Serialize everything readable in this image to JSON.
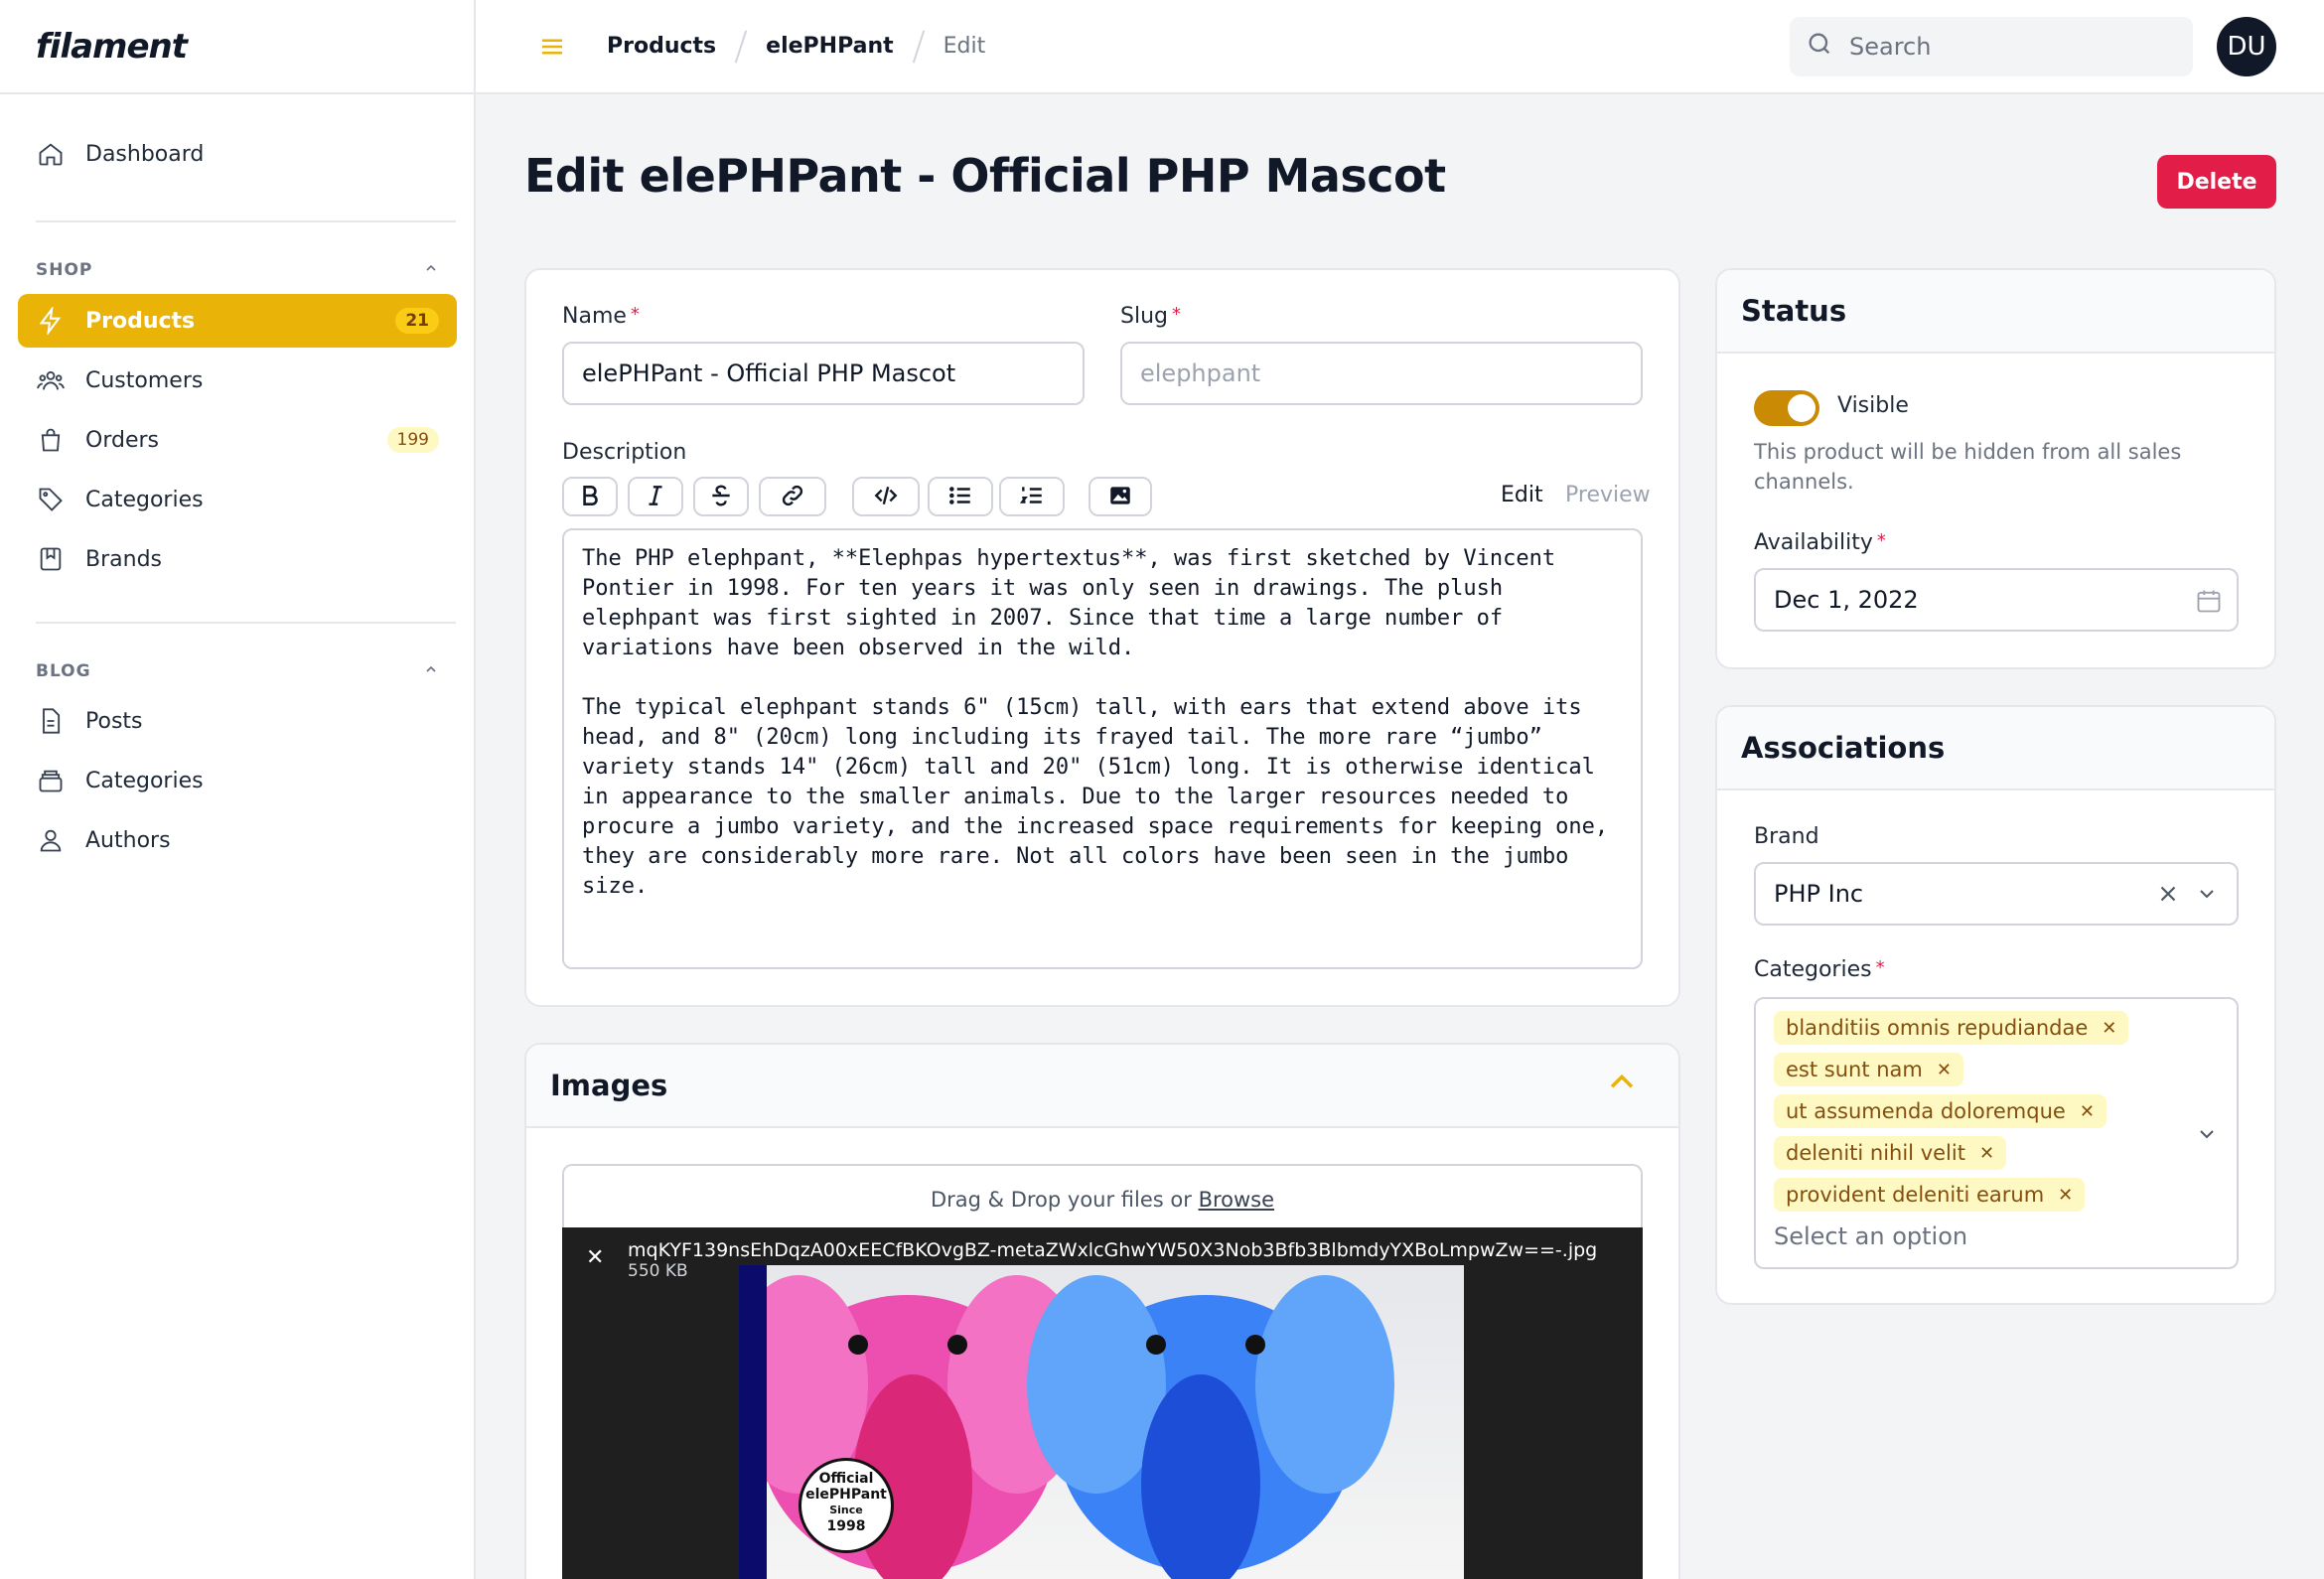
{
  "app": {
    "logo": "filament"
  },
  "sidebar": {
    "dashboard": "Dashboard",
    "shop": {
      "heading": "SHOP",
      "items": [
        {
          "label": "Products",
          "badge": "21",
          "active": true,
          "icon": "bolt-icon"
        },
        {
          "label": "Customers",
          "badge": "",
          "icon": "users-icon"
        },
        {
          "label": "Orders",
          "badge": "199",
          "icon": "shopping-bag-icon"
        },
        {
          "label": "Categories",
          "badge": "",
          "icon": "tag-icon"
        },
        {
          "label": "Brands",
          "badge": "",
          "icon": "bookmark-square-icon"
        }
      ]
    },
    "blog": {
      "heading": "BLOG",
      "items": [
        {
          "label": "Posts",
          "icon": "document-icon"
        },
        {
          "label": "Categories",
          "icon": "inbox-stack-icon"
        },
        {
          "label": "Authors",
          "icon": "user-group-icon"
        }
      ]
    }
  },
  "topbar": {
    "breadcrumbs": [
      "Products",
      "elePHPant",
      "Edit"
    ],
    "search_placeholder": "Search",
    "avatar_initials": "DU"
  },
  "page": {
    "title": "Edit elePHPant - Official PHP Mascot",
    "delete_label": "Delete"
  },
  "form": {
    "name_label": "Name",
    "name_value": "elePHPant - Official PHP Mascot",
    "slug_label": "Slug",
    "slug_value": "elephpant",
    "description_label": "Description",
    "tab_edit": "Edit",
    "tab_preview": "Preview",
    "description": "The PHP elephpant, **Elephpas hypertextus**, was first sketched by Vincent Pontier in 1998. For ten years it was only seen in drawings. The plush elephpant was first sighted in 2007. Since that time a large number of variations have been observed in the wild.\n\nThe typical elephpant stands 6\" (15cm) tall, with ears that extend above its head, and 8\" (20cm) long including its frayed tail. The more rare “jumbo” variety stands 14\" (26cm) tall and 20\" (51cm) long. It is otherwise identical in appearance to the smaller animals. Due to the larger resources needed to procure a jumbo variety, and the increased space requirements for keeping one, they are considerably more rare. Not all colors have been seen in the jumbo size."
  },
  "images": {
    "heading": "Images",
    "dropzone_text": "Drag & Drop your files or ",
    "browse": "Browse",
    "file_name": "mqKYF139nsEhDqzA00xEECfBKOvgBZ-metaZWxlcGhwYW50X3Nob3Bfb3BlbmdyYXBoLmpwZw==-.jpg",
    "file_size": "550 KB",
    "badge_lines": [
      "Official",
      "elePHPant",
      "Since",
      "1998"
    ]
  },
  "status": {
    "heading": "Status",
    "visible_label": "Visible",
    "visible": true,
    "hint": "This product will be hidden from all sales channels.",
    "availability_label": "Availability",
    "availability_value": "Dec 1, 2022"
  },
  "associations": {
    "heading": "Associations",
    "brand_label": "Brand",
    "brand_value": "PHP Inc",
    "categories_label": "Categories",
    "categories": [
      "blanditiis omnis repudiandae",
      "est sunt nam",
      "ut assumenda doloremque",
      "deleniti nihil velit",
      "provident deleniti earum"
    ],
    "categories_placeholder": "Select an option"
  },
  "colors": {
    "accent": "#eab308",
    "danger": "#e11d48"
  }
}
